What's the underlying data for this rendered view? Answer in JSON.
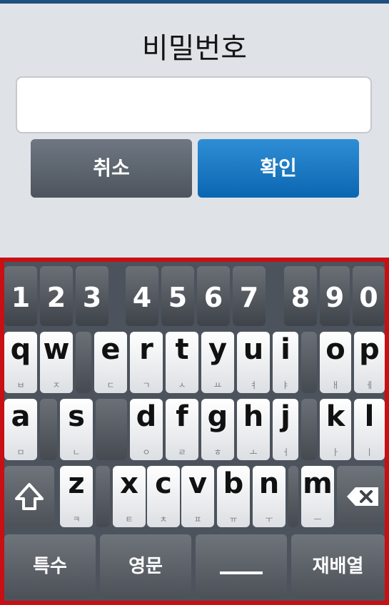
{
  "dialog": {
    "title": "비밀번호",
    "password_value": "",
    "cancel_label": "취소",
    "confirm_label": "확인"
  },
  "keyboard": {
    "numbers": [
      "1",
      "2",
      "3",
      "4",
      "5",
      "6",
      "7",
      "8",
      "9",
      "0"
    ],
    "row1": [
      {
        "l": "q",
        "h": "ㅂ"
      },
      {
        "l": "w",
        "h": "ㅈ"
      },
      {
        "l": "e",
        "h": "ㄷ"
      },
      {
        "l": "r",
        "h": "ㄱ"
      },
      {
        "l": "t",
        "h": "ㅅ"
      },
      {
        "l": "y",
        "h": "ㅛ"
      },
      {
        "l": "u",
        "h": "ㅕ"
      },
      {
        "l": "i",
        "h": "ㅑ"
      },
      {
        "l": "o",
        "h": "ㅐ"
      },
      {
        "l": "p",
        "h": "ㅔ"
      }
    ],
    "row2": [
      {
        "l": "a",
        "h": "ㅁ"
      },
      {
        "l": "s",
        "h": "ㄴ"
      },
      {
        "l": "d",
        "h": "ㅇ"
      },
      {
        "l": "f",
        "h": "ㄹ"
      },
      {
        "l": "g",
        "h": "ㅎ"
      },
      {
        "l": "h",
        "h": "ㅗ"
      },
      {
        "l": "j",
        "h": "ㅓ"
      },
      {
        "l": "k",
        "h": "ㅏ"
      },
      {
        "l": "l",
        "h": "ㅣ"
      }
    ],
    "row3": [
      {
        "l": "z",
        "h": "ㅋ"
      },
      {
        "l": "x",
        "h": "ㅌ"
      },
      {
        "l": "c",
        "h": "ㅊ"
      },
      {
        "l": "v",
        "h": "ㅍ"
      },
      {
        "l": "b",
        "h": "ㅠ"
      },
      {
        "l": "n",
        "h": "ㅜ"
      },
      {
        "l": "m",
        "h": "ㅡ"
      }
    ],
    "special_label": "특수",
    "language_label": "영문",
    "rearrange_label": "재배열",
    "shift_icon": "shift-arrow-icon",
    "backspace_icon": "backspace-x-icon",
    "space_icon": "space-bar-icon"
  },
  "colors": {
    "confirm_blue": "#0b66b1",
    "keyboard_highlight_border": "#c80f14"
  }
}
